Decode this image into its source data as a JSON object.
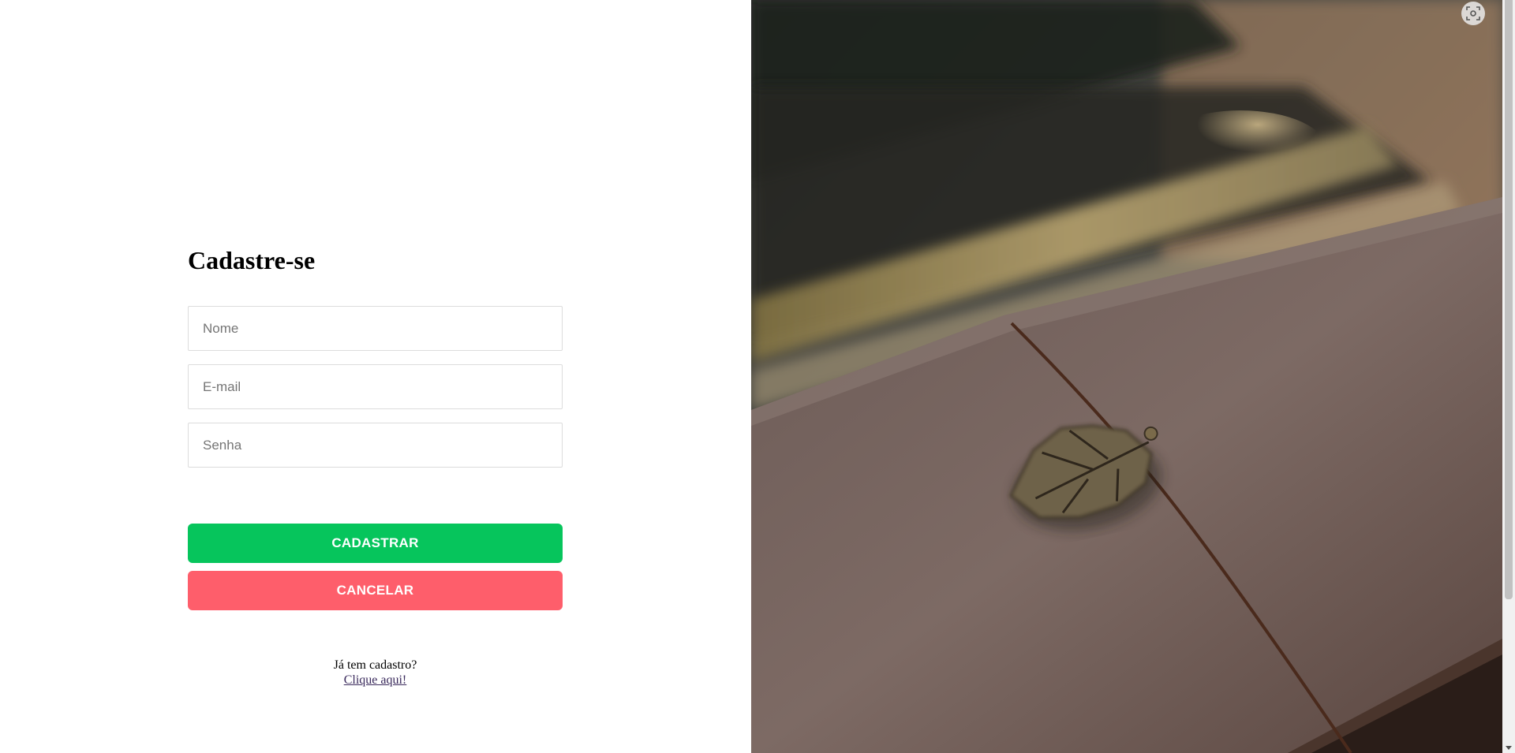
{
  "form": {
    "title": "Cadastre-se",
    "name_placeholder": "Nome",
    "email_placeholder": "E-mail",
    "password_placeholder": "Senha",
    "register_label": "CADASTRAR",
    "cancel_label": "CANCELAR",
    "login_prompt": "Já tem cadastro?",
    "login_link": "Clique aqui!"
  },
  "colors": {
    "register_button": "#06c55c",
    "cancel_button": "#fe5e6b"
  },
  "hero": {
    "description_icon": "notebook-photo",
    "overlay_icon": "visual-search-icon"
  }
}
